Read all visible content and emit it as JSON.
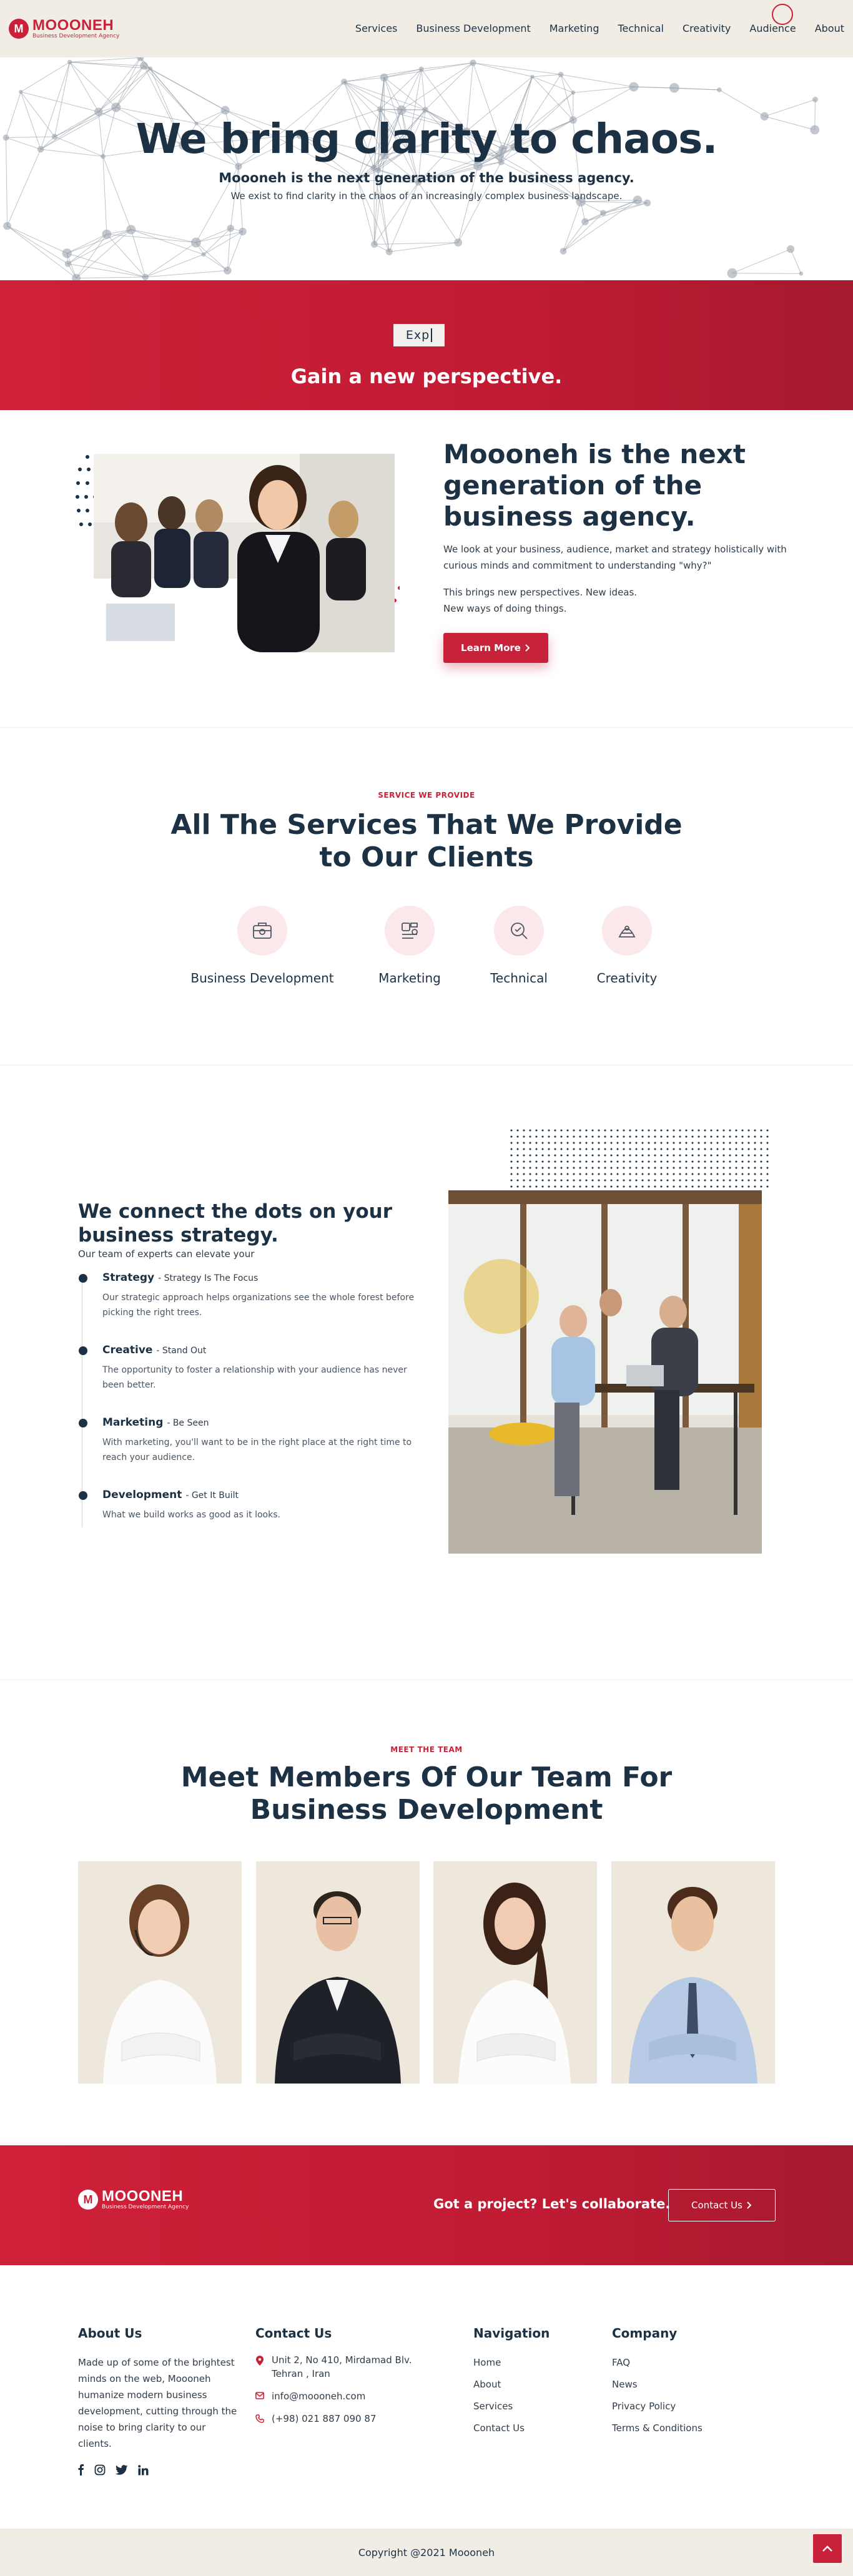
{
  "brand": {
    "name": "MOOONEH",
    "tagline": "Business Development Agency",
    "logo_letter": "M"
  },
  "nav": {
    "items": [
      "Services",
      "Business Development",
      "Marketing",
      "Technical",
      "Creativity",
      "Audience",
      "About"
    ]
  },
  "hero": {
    "title": "We bring clarity to chaos.",
    "subtitle": "Moooneh is the next generation of the business agency.",
    "description": "We exist to find clarity in the chaos of an increasingly complex business landscape."
  },
  "band": {
    "typing_text": "Exp",
    "title": "Gain a new perspective."
  },
  "about": {
    "title": "Moooneh is the next generation of the business agency.",
    "paragraph1": "We look at your business, audience, market and strategy holistically with curious minds and commitment to understanding \"why?\"",
    "paragraph2_line1": "This brings new perspectives. New ideas.",
    "paragraph2_line2": "New ways of doing things.",
    "button": "Learn More"
  },
  "services": {
    "eyebrow": "SERVICE WE PROVIDE",
    "title_line1": "All The Services That We Provide",
    "title_line2": "to Our Clients",
    "items": [
      {
        "label": "Business Development",
        "icon": "business-development-icon"
      },
      {
        "label": "Marketing",
        "icon": "marketing-icon"
      },
      {
        "label": "Technical",
        "icon": "technical-icon"
      },
      {
        "label": "Creativity",
        "icon": "creativity-icon"
      }
    ]
  },
  "connect": {
    "title": "We connect the dots on your business strategy.",
    "subtitle": "Our team of experts can elevate your",
    "items": [
      {
        "name": "Strategy",
        "tag": "- Strategy Is The Focus",
        "text": "Our strategic approach helps organizations see the whole forest before picking the right trees."
      },
      {
        "name": "Creative",
        "tag": "- Stand Out",
        "text": "The opportunity to foster a relationship with your audience has never been better."
      },
      {
        "name": "Marketing",
        "tag": "- Be Seen",
        "text": "With marketing, you'll want to be in the right place at the right time to reach your audience."
      },
      {
        "name": "Development",
        "tag": "- Get It Built",
        "text": "What we build works as good as it looks."
      }
    ]
  },
  "team": {
    "eyebrow": "MEET THE TEAM",
    "title_line1": "Meet Members Of Our Team For",
    "title_line2": "Business Development"
  },
  "cta": {
    "text": "Got a project? Let's collaborate.",
    "button": "Contact Us"
  },
  "footer": {
    "about_title": "About Us",
    "about_text": "Made up of some of the brightest minds on the web, Moooneh humanize modern business development, cutting through the noise to bring clarity to our clients.",
    "contact_title": "Contact Us",
    "address": "Unit 2, No 410, Mirdamad Blv. Tehran , Iran",
    "email": "info@moooneh.com",
    "phone": "(+98) 021 887 090 87",
    "navigation_title": "Navigation",
    "navigation": [
      "Home",
      "About",
      "Services",
      "Contact Us"
    ],
    "company_title": "Company",
    "company": [
      "FAQ",
      "News",
      "Privacy Policy",
      "Terms & Conditions"
    ]
  },
  "copyright": "Copyright @2021 Moooneh",
  "colors": {
    "accent": "#c8223a",
    "navy": "#1c3144",
    "cream": "#f1ede5"
  }
}
